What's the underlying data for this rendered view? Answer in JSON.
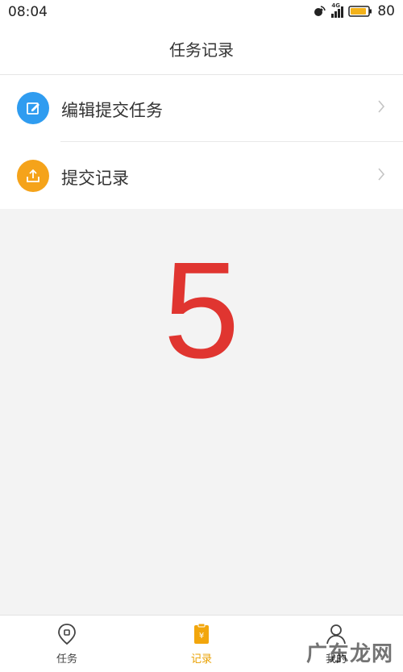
{
  "status_bar": {
    "time": "08:04",
    "network_label": "4G",
    "battery": "80"
  },
  "header": {
    "title": "任务记录"
  },
  "menu": {
    "items": [
      {
        "label": "编辑提交任务",
        "icon": "edit-icon",
        "icon_color": "#2f9cf0"
      },
      {
        "label": "提交记录",
        "icon": "upload-icon",
        "icon_color": "#f5a31a"
      }
    ]
  },
  "overlay": {
    "number": "5",
    "color": "#e03530"
  },
  "tabbar": {
    "tabs": [
      {
        "label": "任务",
        "icon": "location-pin-icon",
        "active": false
      },
      {
        "label": "记录",
        "icon": "clipboard-icon",
        "active": true
      },
      {
        "label": "我的",
        "icon": "person-icon",
        "active": false
      }
    ],
    "active_color": "#e9a000"
  },
  "watermark": {
    "text": "广东龙网"
  }
}
